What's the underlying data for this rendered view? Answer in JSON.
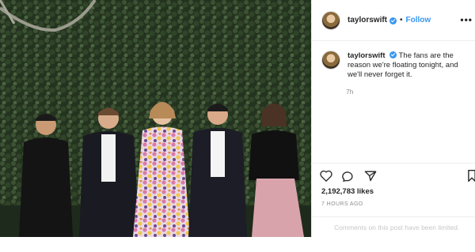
{
  "header": {
    "username": "taylorswift",
    "separator": "•",
    "follow_label": "Follow",
    "more_label": "•••"
  },
  "caption": {
    "username": "taylorswift",
    "text": "The fans are the reason we're floating tonight, and we'll never forget it.",
    "time": "7h"
  },
  "actions": {
    "likes": "2,192,783 likes",
    "posted_ago": "7 HOURS AGO",
    "comments_notice": "Comments on this post have been limited."
  },
  "icons": [
    "heart-icon",
    "comment-icon",
    "share-icon",
    "bookmark-icon",
    "verified-badge-icon"
  ],
  "colors": {
    "accent": "#3897f0",
    "text": "#262626",
    "muted": "#8e8e8e",
    "divider": "#efefef"
  }
}
